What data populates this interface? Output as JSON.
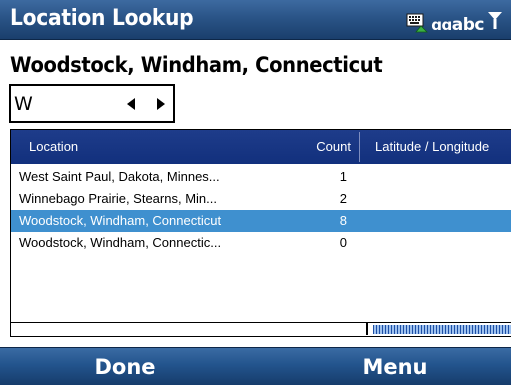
{
  "titlebar": {
    "title": "Location Lookup",
    "input_mode": "abc",
    "icons": [
      "keyboard-icon",
      "input-mode-icon",
      "signal-icon"
    ]
  },
  "heading": "Woodstock, Windham, Connecticut",
  "picker": {
    "value": "W"
  },
  "list": {
    "columns": [
      "Location",
      "Count",
      "Latitude / Longitude"
    ],
    "rows": [
      {
        "location": "West Saint Paul, Dakota, Minnes...",
        "count": "1"
      },
      {
        "location": "Winnebago Prairie, Stearns, Min...",
        "count": "2"
      },
      {
        "location": "Woodstock, Windham, Connecticut",
        "count": "8"
      },
      {
        "location": "Woodstock, Windham, Connectic...",
        "count": "0"
      }
    ],
    "selected_index": 2
  },
  "softkeys": {
    "left": "Done",
    "right": "Menu"
  },
  "colors": {
    "titlebar": "#2a5487",
    "header": "#12307d",
    "selection": "#3f90cf"
  }
}
